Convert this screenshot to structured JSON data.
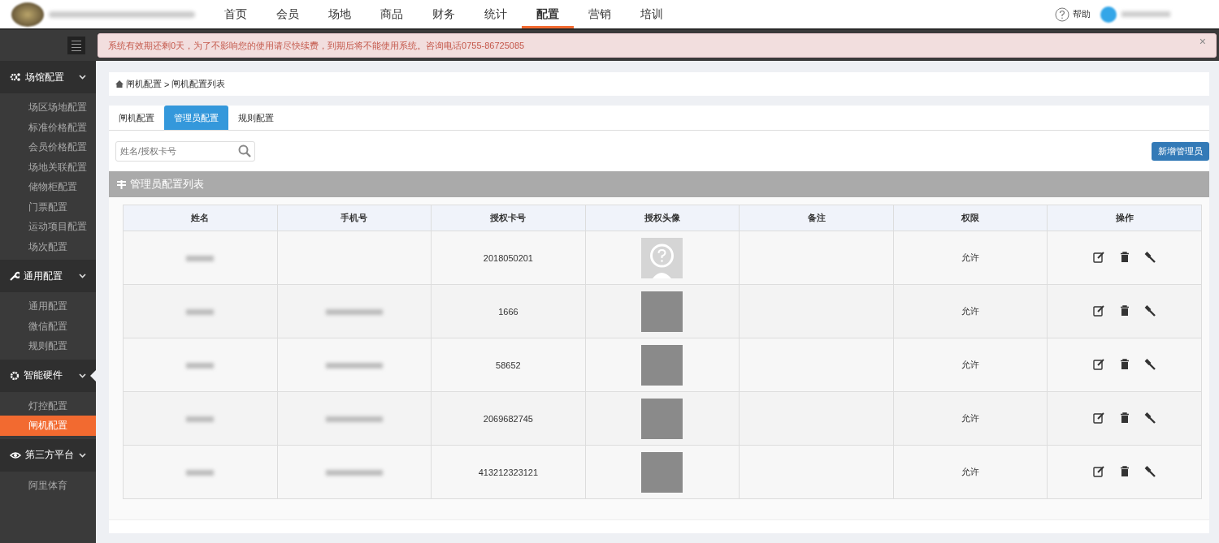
{
  "nav": [
    {
      "label": "首页",
      "selected": false
    },
    {
      "label": "会员",
      "selected": false
    },
    {
      "label": "场地",
      "selected": false
    },
    {
      "label": "商品",
      "selected": false
    },
    {
      "label": "财务",
      "selected": false
    },
    {
      "label": "统计",
      "selected": false
    },
    {
      "label": "配置",
      "selected": true
    },
    {
      "label": "营销",
      "selected": false
    },
    {
      "label": "培训",
      "selected": false
    }
  ],
  "help": "帮助",
  "alert": {
    "text": "系统有效期还剩0天，为了不影响您的使用请尽快续费，到期后将不能使用系统。咨询电话0755-86725085",
    "close": "×"
  },
  "sidebar": [
    {
      "label": "场馆配置",
      "kind": "gears",
      "selected": false,
      "items": [
        {
          "label": "场区场地配置",
          "selected": false
        },
        {
          "label": "标准价格配置",
          "selected": false
        },
        {
          "label": "会员价格配置",
          "selected": false
        },
        {
          "label": "场地关联配置",
          "selected": false
        },
        {
          "label": "储物柜配置",
          "selected": false
        },
        {
          "label": "门票配置",
          "selected": false
        },
        {
          "label": "运动项目配置",
          "selected": false
        },
        {
          "label": "场次配置",
          "selected": false
        }
      ]
    },
    {
      "label": "通用配置",
      "kind": "wrench",
      "selected": false,
      "items": [
        {
          "label": "通用配置",
          "selected": false
        },
        {
          "label": "微信配置",
          "selected": false
        },
        {
          "label": "规则配置",
          "selected": false
        }
      ]
    },
    {
      "label": "智能硬件",
      "kind": "gear",
      "selected": true,
      "items": [
        {
          "label": "灯控配置",
          "selected": false
        },
        {
          "label": "闸机配置",
          "selected": true
        }
      ]
    },
    {
      "label": "第三方平台",
      "kind": "eye",
      "selected": false,
      "items": [
        {
          "label": "阿里体育",
          "selected": false
        }
      ]
    }
  ],
  "breadcrumb": {
    "items": [
      "闸机配置",
      "闸机配置列表"
    ],
    "separator": ">"
  },
  "tabs": [
    {
      "label": "闸机配置",
      "selected": false
    },
    {
      "label": "管理员配置",
      "selected": true
    },
    {
      "label": "规则配置",
      "selected": false
    }
  ],
  "search": {
    "placeholder": "姓名/授权卡号"
  },
  "add_button": "新增管理员",
  "panel_title": "管理员配置列表",
  "table": {
    "columns": [
      "姓名",
      "手机号",
      "授权卡号",
      "授权头像",
      "备注",
      "权限",
      "操作"
    ],
    "rows": [
      {
        "phone": {
          "kind": "empty"
        },
        "card": "2018050201",
        "avatar": {
          "kind": "default"
        },
        "permission": "允许"
      },
      {
        "phone": {
          "kind": "blurred"
        },
        "card": "1666",
        "avatar": {
          "kind": "photo"
        },
        "permission": "允许"
      },
      {
        "phone": {
          "kind": "blurred"
        },
        "card": "58652",
        "avatar": {
          "kind": "photo"
        },
        "permission": "允许"
      },
      {
        "phone": {
          "kind": "blurred"
        },
        "card": "2069682745",
        "avatar": {
          "kind": "photo"
        },
        "permission": "允许"
      },
      {
        "phone": {
          "kind": "blurred"
        },
        "card": "413212323121",
        "avatar": {
          "kind": "photo"
        },
        "permission": "允许"
      }
    ]
  }
}
